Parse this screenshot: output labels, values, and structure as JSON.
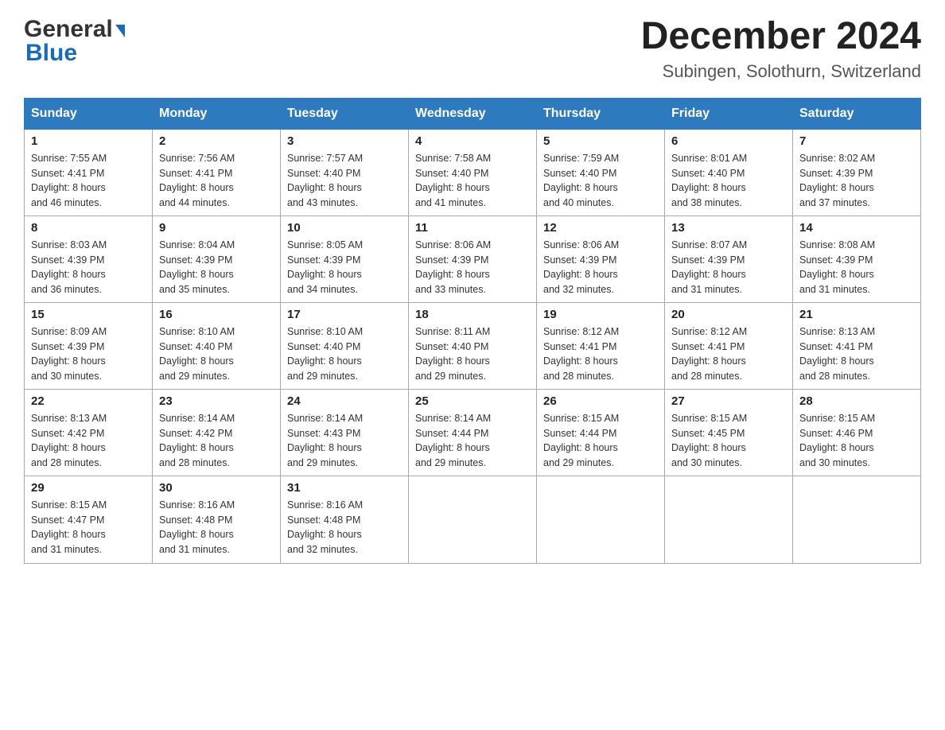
{
  "header": {
    "logo_general": "General",
    "logo_blue": "Blue",
    "month_year": "December 2024",
    "location": "Subingen, Solothurn, Switzerland"
  },
  "days_of_week": [
    "Sunday",
    "Monday",
    "Tuesday",
    "Wednesday",
    "Thursday",
    "Friday",
    "Saturday"
  ],
  "weeks": [
    [
      {
        "day": "1",
        "sunrise": "7:55 AM",
        "sunset": "4:41 PM",
        "daylight": "8 hours and 46 minutes."
      },
      {
        "day": "2",
        "sunrise": "7:56 AM",
        "sunset": "4:41 PM",
        "daylight": "8 hours and 44 minutes."
      },
      {
        "day": "3",
        "sunrise": "7:57 AM",
        "sunset": "4:40 PM",
        "daylight": "8 hours and 43 minutes."
      },
      {
        "day": "4",
        "sunrise": "7:58 AM",
        "sunset": "4:40 PM",
        "daylight": "8 hours and 41 minutes."
      },
      {
        "day": "5",
        "sunrise": "7:59 AM",
        "sunset": "4:40 PM",
        "daylight": "8 hours and 40 minutes."
      },
      {
        "day": "6",
        "sunrise": "8:01 AM",
        "sunset": "4:40 PM",
        "daylight": "8 hours and 38 minutes."
      },
      {
        "day": "7",
        "sunrise": "8:02 AM",
        "sunset": "4:39 PM",
        "daylight": "8 hours and 37 minutes."
      }
    ],
    [
      {
        "day": "8",
        "sunrise": "8:03 AM",
        "sunset": "4:39 PM",
        "daylight": "8 hours and 36 minutes."
      },
      {
        "day": "9",
        "sunrise": "8:04 AM",
        "sunset": "4:39 PM",
        "daylight": "8 hours and 35 minutes."
      },
      {
        "day": "10",
        "sunrise": "8:05 AM",
        "sunset": "4:39 PM",
        "daylight": "8 hours and 34 minutes."
      },
      {
        "day": "11",
        "sunrise": "8:06 AM",
        "sunset": "4:39 PM",
        "daylight": "8 hours and 33 minutes."
      },
      {
        "day": "12",
        "sunrise": "8:06 AM",
        "sunset": "4:39 PM",
        "daylight": "8 hours and 32 minutes."
      },
      {
        "day": "13",
        "sunrise": "8:07 AM",
        "sunset": "4:39 PM",
        "daylight": "8 hours and 31 minutes."
      },
      {
        "day": "14",
        "sunrise": "8:08 AM",
        "sunset": "4:39 PM",
        "daylight": "8 hours and 31 minutes."
      }
    ],
    [
      {
        "day": "15",
        "sunrise": "8:09 AM",
        "sunset": "4:39 PM",
        "daylight": "8 hours and 30 minutes."
      },
      {
        "day": "16",
        "sunrise": "8:10 AM",
        "sunset": "4:40 PM",
        "daylight": "8 hours and 29 minutes."
      },
      {
        "day": "17",
        "sunrise": "8:10 AM",
        "sunset": "4:40 PM",
        "daylight": "8 hours and 29 minutes."
      },
      {
        "day": "18",
        "sunrise": "8:11 AM",
        "sunset": "4:40 PM",
        "daylight": "8 hours and 29 minutes."
      },
      {
        "day": "19",
        "sunrise": "8:12 AM",
        "sunset": "4:41 PM",
        "daylight": "8 hours and 28 minutes."
      },
      {
        "day": "20",
        "sunrise": "8:12 AM",
        "sunset": "4:41 PM",
        "daylight": "8 hours and 28 minutes."
      },
      {
        "day": "21",
        "sunrise": "8:13 AM",
        "sunset": "4:41 PM",
        "daylight": "8 hours and 28 minutes."
      }
    ],
    [
      {
        "day": "22",
        "sunrise": "8:13 AM",
        "sunset": "4:42 PM",
        "daylight": "8 hours and 28 minutes."
      },
      {
        "day": "23",
        "sunrise": "8:14 AM",
        "sunset": "4:42 PM",
        "daylight": "8 hours and 28 minutes."
      },
      {
        "day": "24",
        "sunrise": "8:14 AM",
        "sunset": "4:43 PM",
        "daylight": "8 hours and 29 minutes."
      },
      {
        "day": "25",
        "sunrise": "8:14 AM",
        "sunset": "4:44 PM",
        "daylight": "8 hours and 29 minutes."
      },
      {
        "day": "26",
        "sunrise": "8:15 AM",
        "sunset": "4:44 PM",
        "daylight": "8 hours and 29 minutes."
      },
      {
        "day": "27",
        "sunrise": "8:15 AM",
        "sunset": "4:45 PM",
        "daylight": "8 hours and 30 minutes."
      },
      {
        "day": "28",
        "sunrise": "8:15 AM",
        "sunset": "4:46 PM",
        "daylight": "8 hours and 30 minutes."
      }
    ],
    [
      {
        "day": "29",
        "sunrise": "8:15 AM",
        "sunset": "4:47 PM",
        "daylight": "8 hours and 31 minutes."
      },
      {
        "day": "30",
        "sunrise": "8:16 AM",
        "sunset": "4:48 PM",
        "daylight": "8 hours and 31 minutes."
      },
      {
        "day": "31",
        "sunrise": "8:16 AM",
        "sunset": "4:48 PM",
        "daylight": "8 hours and 32 minutes."
      },
      null,
      null,
      null,
      null
    ]
  ],
  "labels": {
    "sunrise": "Sunrise:",
    "sunset": "Sunset:",
    "daylight": "Daylight:"
  }
}
